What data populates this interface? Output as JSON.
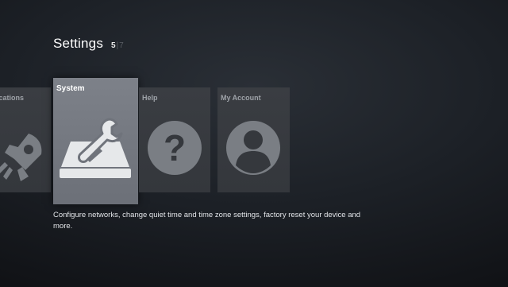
{
  "header": {
    "title": "Settings",
    "position": "5",
    "separator": "|",
    "total": "7"
  },
  "tiles": [
    {
      "label": "ications",
      "icon": "rocket-icon"
    },
    {
      "label": "System",
      "icon": "wrench-drive-icon",
      "selected": true
    },
    {
      "label": "Help",
      "icon": "question-mark-icon"
    },
    {
      "label": "My Account",
      "icon": "user-avatar-icon"
    }
  ],
  "description": "Configure networks, change quiet time and time zone settings, factory reset your device and more.",
  "colors": {
    "selected_tile": "#767a82",
    "tile": "#373a3f",
    "icon_fill": "#7a7e84",
    "icon_fill_selected": "#e6e8ea"
  }
}
